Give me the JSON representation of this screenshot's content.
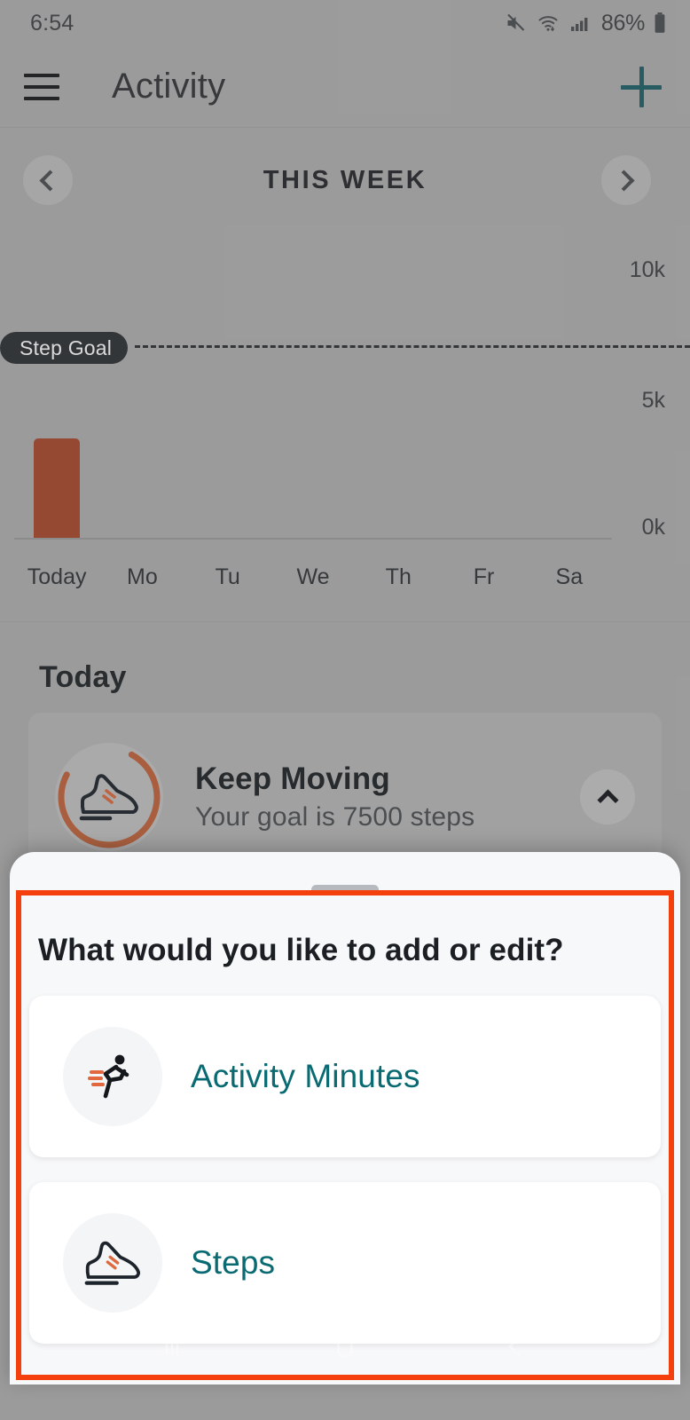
{
  "status_bar": {
    "time": "6:54",
    "battery_percent": "86%",
    "icons": [
      "mute-icon",
      "wifi-icon",
      "cellular-signal-icon",
      "battery-icon"
    ]
  },
  "app_bar": {
    "menu_icon": "hamburger-menu-icon",
    "title": "Activity",
    "add_icon": "plus-icon",
    "accent_color": "#1c5f68"
  },
  "week_nav": {
    "prev_icon": "chevron-left-icon",
    "label": "THIS WEEK",
    "next_icon": "chevron-right-icon"
  },
  "chart_data": {
    "type": "bar",
    "title": "",
    "categories": [
      "Today",
      "Mo",
      "Tu",
      "We",
      "Th",
      "Fr",
      "Sa"
    ],
    "values": [
      4700,
      0,
      0,
      0,
      0,
      0,
      0
    ],
    "ylabel": "",
    "xlabel": "",
    "ylim": [
      0,
      11500
    ],
    "ytick_labels": [
      "10k",
      "5k",
      "0k"
    ],
    "ytick_values": [
      10000,
      5000,
      0
    ],
    "goal_line": {
      "label": "Step Goal",
      "value": 7500,
      "style": "dashed"
    },
    "bar_color": "#a9472a",
    "grid": false,
    "legend": "none"
  },
  "today_section": {
    "heading": "Today",
    "card": {
      "title": "Keep Moving",
      "subtitle": "Your goal is 7500 steps",
      "icon": "running-shoe-icon",
      "progress_ring_color": "#c2633a",
      "progress_percent": 75,
      "toggle_icon": "chevron-up-icon"
    }
  },
  "bottom_sheet": {
    "drag_handle": "drag-handle",
    "title": "What would you like to add or edit?",
    "options": [
      {
        "label": "Activity Minutes",
        "icon": "running-person-icon"
      },
      {
        "label": "Steps",
        "icon": "running-shoe-icon"
      }
    ],
    "label_color": "#0a6a72"
  },
  "annotation": {
    "color": "#f4400d",
    "shape": "rectangle-highlight"
  },
  "nav_bar": {
    "recents_icon": "recents-icon",
    "home_icon": "home-icon",
    "back_icon": "back-icon"
  }
}
